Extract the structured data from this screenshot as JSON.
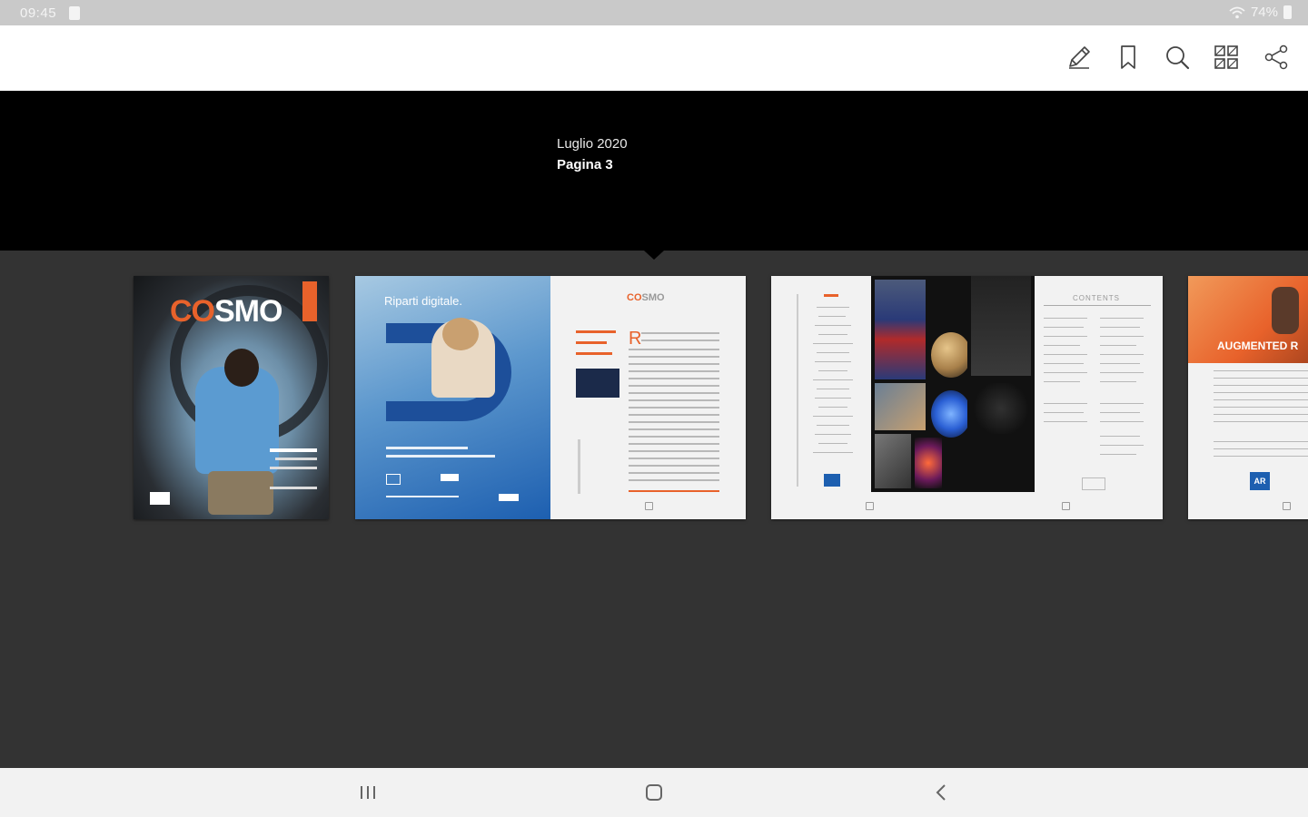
{
  "status_bar": {
    "time": "09:45",
    "battery": "74%"
  },
  "toolbar": {
    "icons": [
      "pencil-icon",
      "bookmark-icon",
      "search-icon",
      "grid-icon",
      "share-icon"
    ]
  },
  "issue": {
    "month": "Luglio 2020",
    "page": "Pagina 3"
  },
  "thumbnails": {
    "cover": {
      "logo_prefix": "CO",
      "logo": "SMO"
    },
    "spread1": {
      "ad_headline": "Riparti digitale.",
      "logo_left": "CO",
      "logo_right": "SMO"
    },
    "spread2": {
      "toc_heading": "CONTENTS"
    },
    "spread3": {
      "headline": "AUGMENTED R",
      "badge": "AR"
    }
  },
  "colors": {
    "accent_orange": "#e8622b",
    "ad_blue": "#1d5fb0",
    "background": "#333333"
  }
}
